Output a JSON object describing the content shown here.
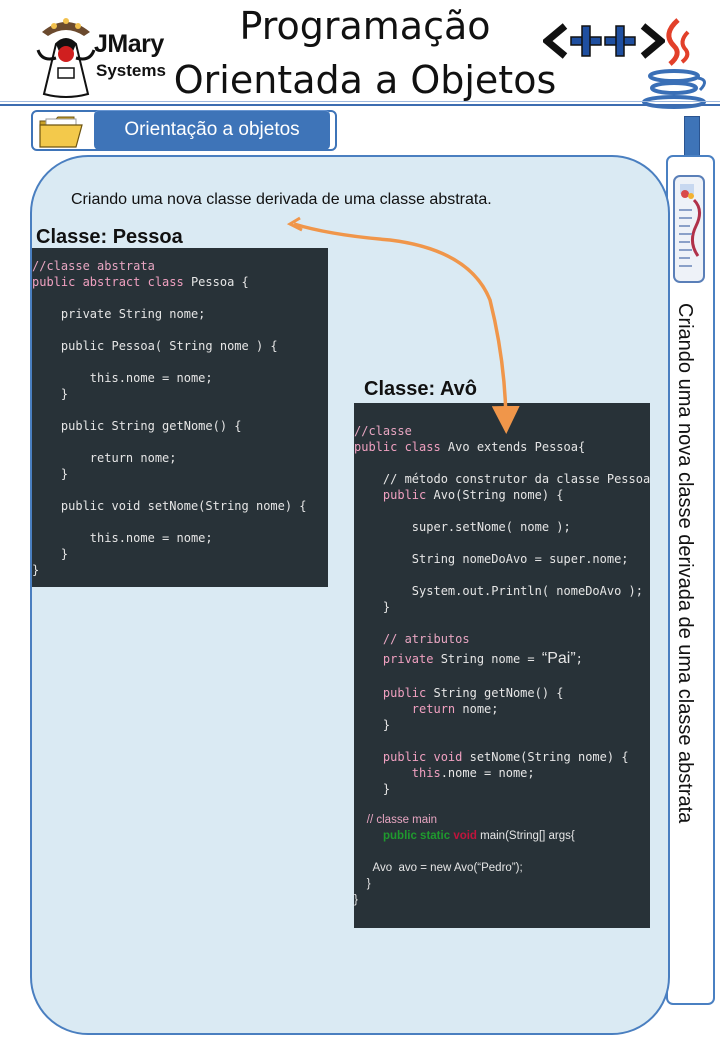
{
  "header": {
    "logo_name": "JMary",
    "logo_sub": "Systems",
    "title_line1": "Programação",
    "title_line2": "Orientada a Objetos"
  },
  "section": {
    "tab_label": "Orientação a objetos"
  },
  "sidebar": {
    "vertical_text": "Criando uma nova classe derivada de uma classe abstrata"
  },
  "content": {
    "intro": "Criando uma nova classe derivada de uma classe abstrata.",
    "heading_pessoa": "Classe: Pessoa",
    "heading_avo": "Classe: Avô"
  },
  "code_pessoa": [
    "//classe abstrata",
    "public abstract class Pessoa {",
    "",
    "    private String nome;",
    "",
    "    public Pessoa( String nome ) {",
    "",
    "        this.nome = nome;",
    "    }",
    "",
    "    public String getNome() {",
    "",
    "        return nome;",
    "    }",
    "",
    "    public void setNome(String nome) {",
    "",
    "        this.nome = nome;",
    "    }",
    "}"
  ],
  "code_avo": {
    "l01": "//classe",
    "l02a": "public class",
    "l02b": " Avo extends Pessoa{",
    "l03": "    // método construtor da classe Pessoa",
    "l04a": "    public",
    "l04b": " Avo(String nome) {",
    "l05": "        super.setNome( nome );",
    "l06": "        String nomeDoAvo = super.nome;",
    "l07": "        System.out.Println( nomeDoAvo );",
    "l08": "    }",
    "l09": "    // atributos",
    "l10a": "    private",
    "l10b": " String nome = ",
    "l10c": "“Pai”",
    "l10d": ";",
    "l11a": "    public",
    "l11b": " String getNome() {",
    "l12a": "        return",
    "l12b": " nome;",
    "l13": "    }",
    "l14a": "    public void",
    "l14b": " setNome(String nome) {",
    "l15a": "        this",
    "l15b": ".nome = nome;",
    "l16": "    }",
    "l17": "    // classe main",
    "l18a": "public static",
    "l18b": "void",
    "l18c": " main(String[] args{",
    "l19": "      Avo  avo = new Avo(“Pedro”);",
    "l20": "    }",
    "l21": "}"
  },
  "icons": {
    "logo": "duke-mascot-icon",
    "cpp": "cpp-logo-icon",
    "java": "java-cup-icon",
    "folder": "folder-icon",
    "newspaper": "newspaper-icon"
  },
  "colors": {
    "accent": "#3e74b8",
    "panel_bg": "#daeaf3",
    "code_bg": "#283238",
    "arrow": "#f0964a"
  }
}
